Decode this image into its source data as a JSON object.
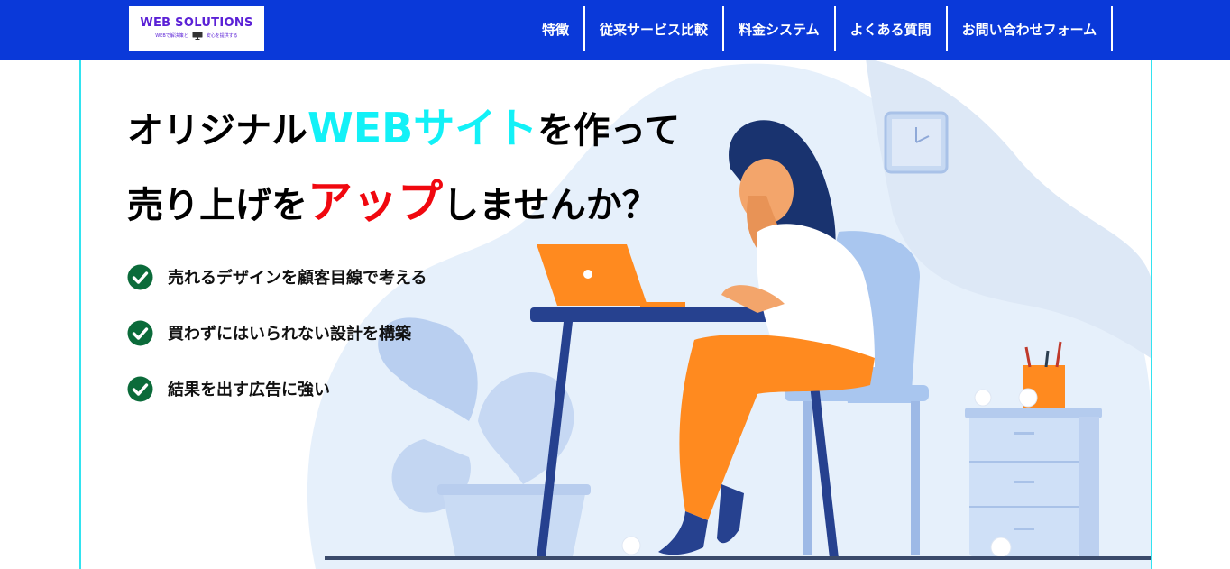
{
  "header": {
    "logo": {
      "title": "WEB SOLUTIONS",
      "tagline_left": "WEBで解決策と",
      "tagline_right": "安心を提供する",
      "tagline_icon": "monitor-icon"
    },
    "nav": [
      {
        "label": "特徴"
      },
      {
        "label": "従来サービス比較"
      },
      {
        "label": "料金システム"
      },
      {
        "label": "よくある質問"
      },
      {
        "label": "お問い合わせフォーム"
      }
    ]
  },
  "hero": {
    "headline_line1": {
      "before": "オリジナル",
      "highlight": "WEBサイト",
      "after": "を作って"
    },
    "headline_line2": {
      "before": "売り上げを",
      "highlight": "アップ",
      "after": "しませんか？"
    },
    "features": [
      {
        "text": "売れるデザインを顧客目線で考える",
        "icon": "check-circle-icon"
      },
      {
        "text": "買わずにはいられない設計を構築",
        "icon": "check-circle-icon"
      },
      {
        "text": "結果を出す広告に強い",
        "icon": "check-circle-icon"
      }
    ],
    "illustration": "woman-at-laptop-illustration"
  },
  "colors": {
    "header_bg": "#0a39d9",
    "accent_cyan": "#12f1f7",
    "accent_red": "#f0080f",
    "check_green": "#0b6b3a",
    "frame_border": "#32e3f0",
    "laptop_orange": "#ff8a1f"
  }
}
